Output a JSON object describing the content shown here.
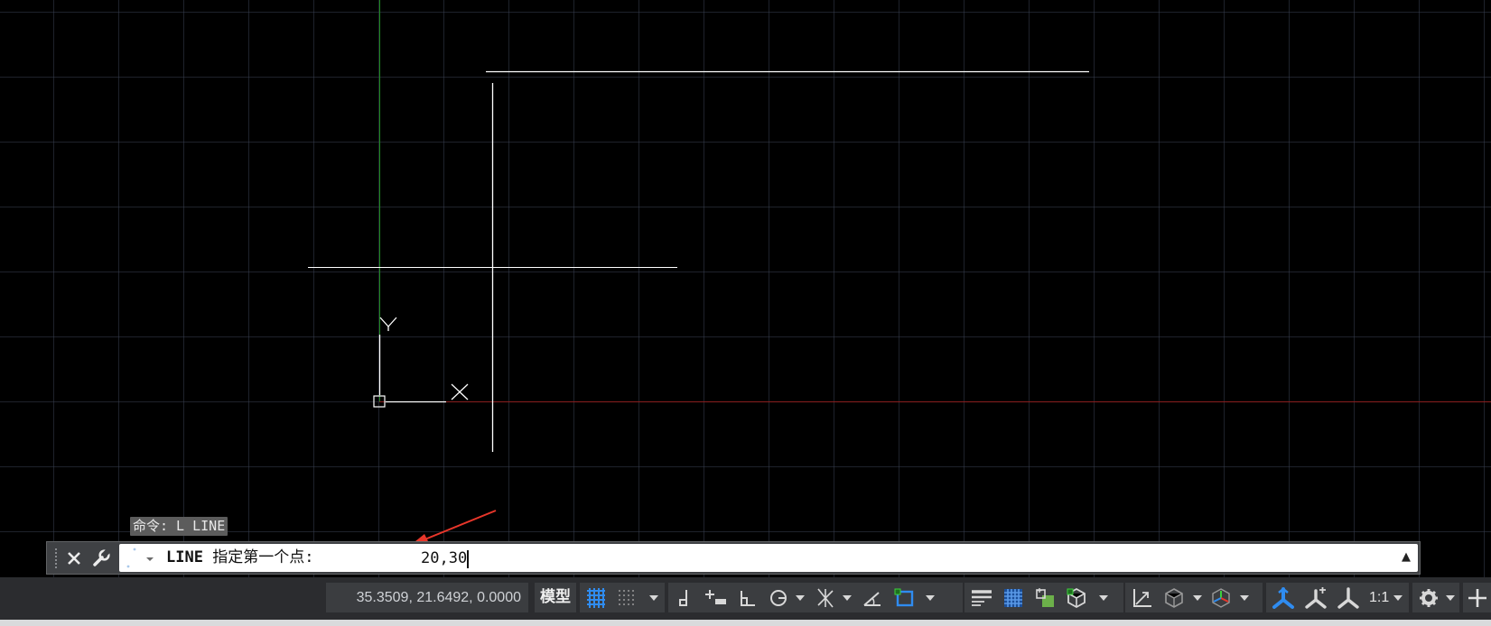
{
  "command_line": {
    "history": "命令: L LINE",
    "prompt_command": "LINE",
    "prompt_text": "指定第一个点:",
    "input_value": "20,30"
  },
  "status_bar": {
    "coordinates": "35.3509, 21.6492, 0.0000",
    "model_tab": "模型",
    "annotation_scale": "1:1"
  },
  "colors": {
    "canvas_bg": "#000000",
    "grid": "#373e4e",
    "drawn_lines": "#ffffff",
    "y_axis": "#1f8a1f",
    "x_axis": "#8a1f1f",
    "annotation_arrow": "#e8362a",
    "active_icon": "#2f8cf0"
  },
  "icons": [
    "close-icon",
    "wrench-icon",
    "recent-commands-icon",
    "scroll-up-icon",
    "grid-icon",
    "snap-icon",
    "infer-constraints-icon",
    "dynamic-input-icon",
    "ortho-icon",
    "polar-icon",
    "isodraft-icon",
    "object-snap-tracking-icon",
    "object-snap-icon",
    "lineweight-icon",
    "transparency-icon",
    "selection-cycling-icon",
    "3d-osnap-icon",
    "dynamic-ucs-icon",
    "selection-filter-icon",
    "gizmo-icon",
    "annotation-visibility-icon",
    "autoscale-icon",
    "annotation-scale-icon",
    "workspace-gear-icon",
    "customize-plus-icon"
  ]
}
